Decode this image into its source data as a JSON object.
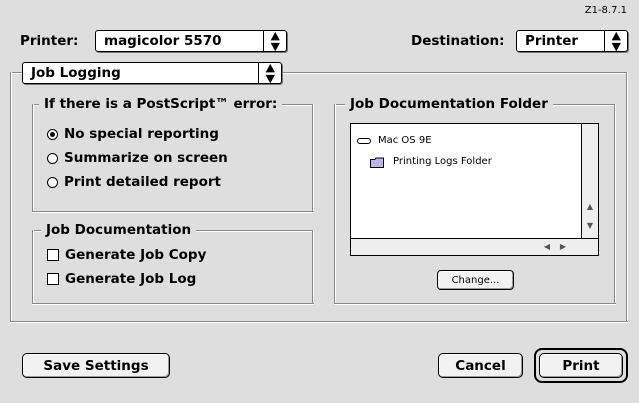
{
  "version": "Z1-8.7.1",
  "printer": {
    "label": "Printer:",
    "value": "magicolor 5570"
  },
  "destination": {
    "label": "Destination:",
    "value": "Printer"
  },
  "panel_menu": {
    "value": "Job Logging"
  },
  "postscript_error": {
    "title": "If there is a PostScript™ error:",
    "options": [
      {
        "label": "No special reporting",
        "selected": true
      },
      {
        "label": "Summarize on screen",
        "selected": false
      },
      {
        "label": "Print detailed report",
        "selected": false
      }
    ]
  },
  "job_documentation": {
    "title": "Job Documentation",
    "options": [
      {
        "label": "Generate Job Copy",
        "checked": false
      },
      {
        "label": "Generate Job Log",
        "checked": false
      }
    ]
  },
  "doc_folder": {
    "title": "Job Documentation Folder",
    "items": [
      {
        "icon": "disk-icon",
        "label": "Mac OS 9E"
      },
      {
        "icon": "folder-icon",
        "label": "Printing Logs Folder"
      }
    ],
    "change_label": "Change..."
  },
  "footer": {
    "save_label": "Save Settings",
    "cancel_label": "Cancel",
    "print_label": "Print"
  }
}
